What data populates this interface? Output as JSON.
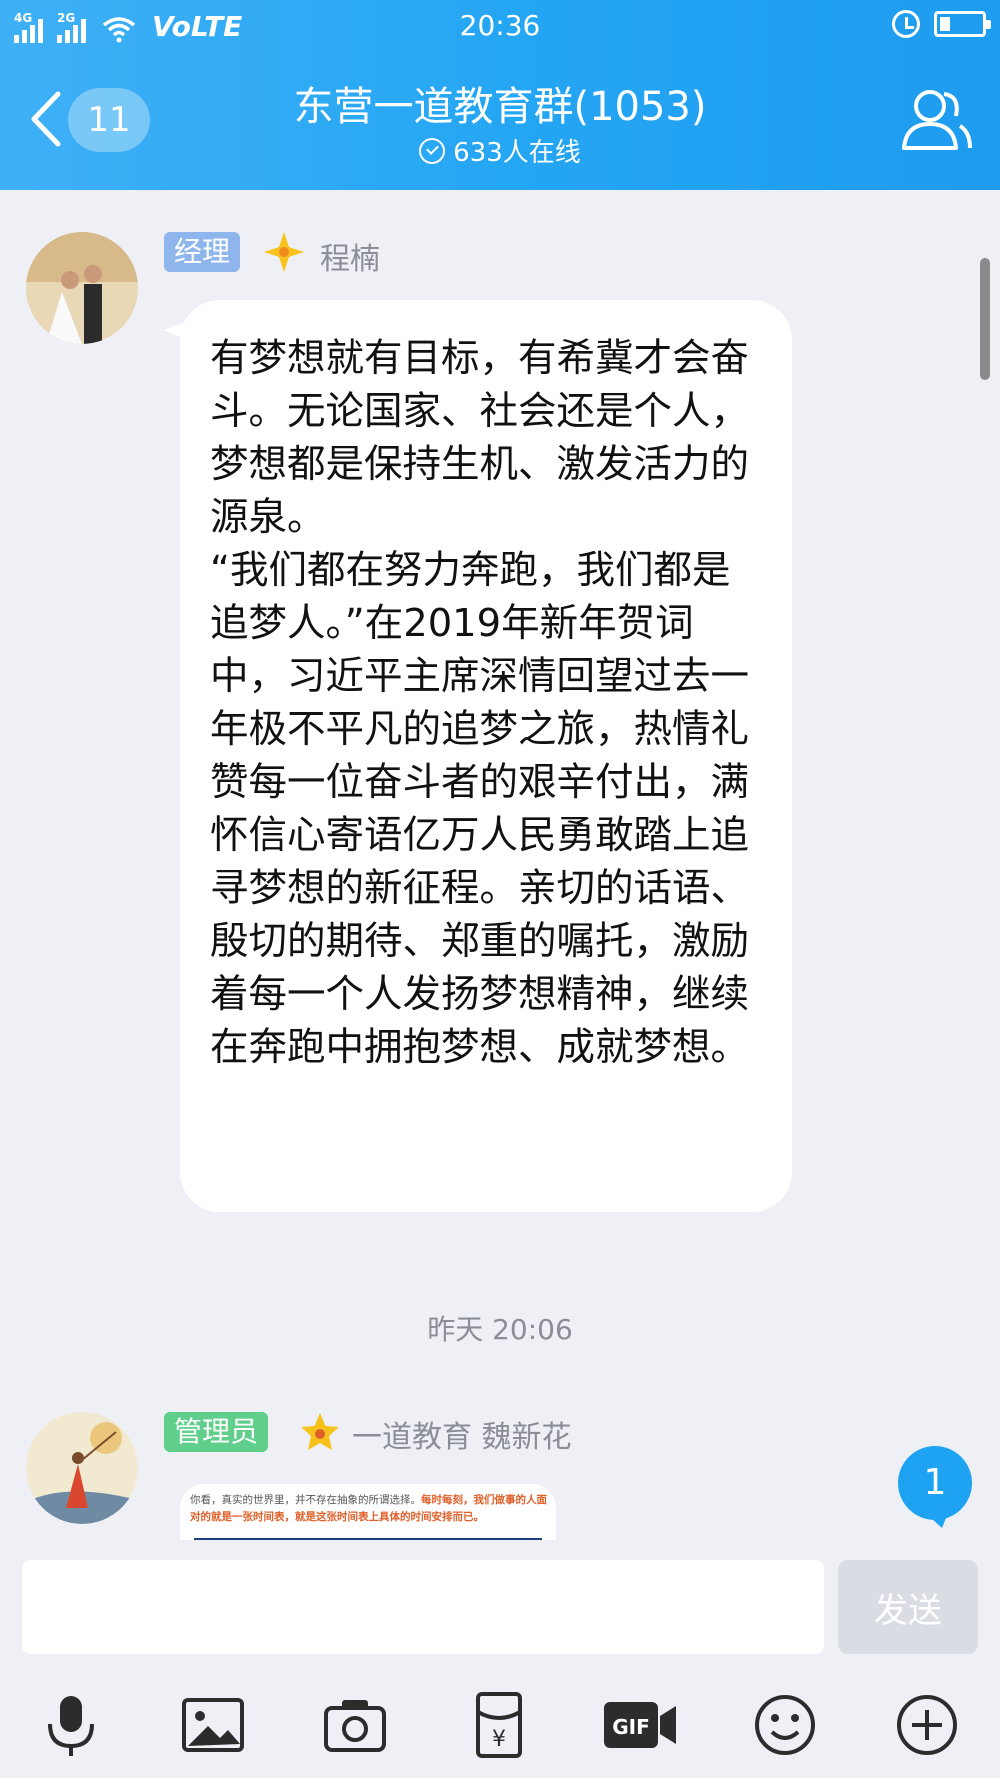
{
  "status_bar": {
    "signal_4g": "4G",
    "signal_2g": "2G",
    "network": "VoLTE",
    "time": "20:36"
  },
  "nav": {
    "back_badge": "11",
    "title": "东营一道教育群(1053)",
    "online": "633人在线"
  },
  "messages": [
    {
      "role_tag": "经理",
      "role_color": "#8fb6ec",
      "sender": "程楠",
      "text": "有梦想就有目标，有希冀才会奋斗。无论国家、社会还是个人，梦想都是保持生机、激发活力的源泉。\n“我们都在努力奔跑，我们都是追梦人。”在2019年新年贺词中，习近平主席深情回望过去一年极不平凡的追梦之旅，热情礼赞每一位奋斗者的艰辛付出，满怀信心寄语亿万人民勇敢踏上追寻梦想的新征程。亲切的话语、殷切的期待、郑重的嘱托，激励着每一个人发扬梦想精神，继续在奔跑中拥抱梦想、成就梦想。"
    },
    {
      "role_tag": "管理员",
      "role_color": "#5fcf8b",
      "sender": "一道教育 魏新花",
      "image_text_normal": "你看，真实的世界里，并不存在抽象的所谓选择。",
      "image_text_highlight": "每时每刻，我们做事的人面对的就是一张时间表，就是这张时间表上具体的时间安排而已。"
    }
  ],
  "timestamp": "昨天 20:06",
  "unread_count": "1",
  "input": {
    "value": "",
    "send_label": "发送"
  },
  "toolbar_icons": [
    "microphone-icon",
    "image-icon",
    "camera-icon",
    "red-packet-icon",
    "gif-icon",
    "emoji-icon",
    "plus-icon"
  ],
  "colors": {
    "header": "#25a6f3",
    "background": "#eef0f6",
    "unread": "#1ea3f2"
  }
}
